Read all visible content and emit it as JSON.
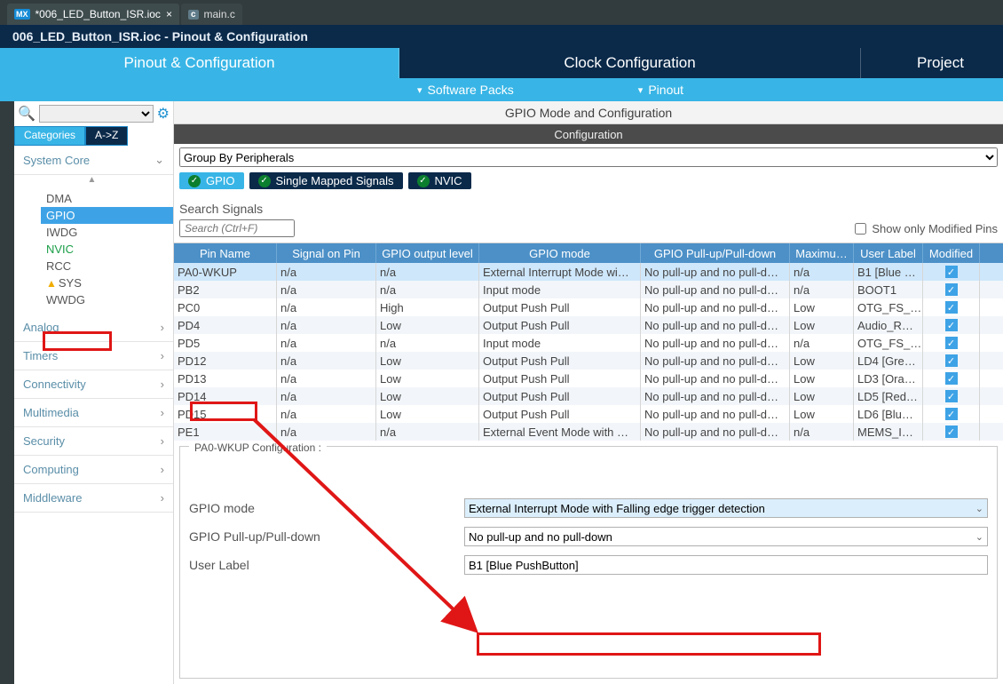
{
  "editorTabs": [
    {
      "label": "*006_LED_Button_ISR.ioc",
      "badge": "MX",
      "active": true,
      "closeable": true
    },
    {
      "label": "main.c",
      "badge": "c",
      "active": false,
      "closeable": false
    }
  ],
  "breadcrumb": "006_LED_Button_ISR.ioc - Pinout & Configuration",
  "bigTabs": {
    "pinout": "Pinout & Configuration",
    "clock": "Clock Configuration",
    "project": "Project"
  },
  "subMenus": {
    "packs": "Software Packs",
    "pinout": "Pinout"
  },
  "leftSearchPlaceholder": "",
  "modeTabs": {
    "categories": "Categories",
    "az": "A->Z"
  },
  "tree": {
    "systemCore": {
      "label": "System Core",
      "items": [
        {
          "label": "DMA"
        },
        {
          "label": "GPIO",
          "selected": true
        },
        {
          "label": "IWDG"
        },
        {
          "label": "NVIC",
          "green": true
        },
        {
          "label": "RCC"
        },
        {
          "label": "SYS",
          "warn": true
        },
        {
          "label": "WWDG"
        }
      ]
    },
    "sections": [
      "Analog",
      "Timers",
      "Connectivity",
      "Multimedia",
      "Security",
      "Computing",
      "Middleware"
    ]
  },
  "mainHeader": "GPIO Mode and Configuration",
  "configHeader": "Configuration",
  "groupByLabel": "Group By Peripherals",
  "pillTabs": {
    "gpio": "GPIO",
    "single": "Single Mapped Signals",
    "nvic": "NVIC"
  },
  "searchSignalsLabel": "Search Signals",
  "searchSignalsPlaceholder": "Search (Ctrl+F)",
  "showModifiedLabel": "Show only Modified Pins",
  "columns": {
    "pin": "Pin Name",
    "sig": "Signal on Pin",
    "out": "GPIO output level",
    "mode": "GPIO mode",
    "pull": "GPIO Pull-up/Pull-down",
    "max": "Maximu…",
    "lbl": "User Label",
    "mod": "Modified"
  },
  "rows": [
    {
      "pin": "PA0-WKUP",
      "sig": "n/a",
      "out": "n/a",
      "mode": "External Interrupt Mode wi…",
      "pull": "No pull-up and no pull-d…",
      "max": "n/a",
      "lbl": "B1 [Blue …",
      "mod": true,
      "sel": true
    },
    {
      "pin": "PB2",
      "sig": "n/a",
      "out": "n/a",
      "mode": "Input mode",
      "pull": "No pull-up and no pull-d…",
      "max": "n/a",
      "lbl": "BOOT1",
      "mod": true
    },
    {
      "pin": "PC0",
      "sig": "n/a",
      "out": "High",
      "mode": "Output Push Pull",
      "pull": "No pull-up and no pull-d…",
      "max": "Low",
      "lbl": "OTG_FS_…",
      "mod": true
    },
    {
      "pin": "PD4",
      "sig": "n/a",
      "out": "Low",
      "mode": "Output Push Pull",
      "pull": "No pull-up and no pull-d…",
      "max": "Low",
      "lbl": "Audio_R…",
      "mod": true
    },
    {
      "pin": "PD5",
      "sig": "n/a",
      "out": "n/a",
      "mode": "Input mode",
      "pull": "No pull-up and no pull-d…",
      "max": "n/a",
      "lbl": "OTG_FS_…",
      "mod": true
    },
    {
      "pin": "PD12",
      "sig": "n/a",
      "out": "Low",
      "mode": "Output Push Pull",
      "pull": "No pull-up and no pull-d…",
      "max": "Low",
      "lbl": "LD4 [Gre…",
      "mod": true
    },
    {
      "pin": "PD13",
      "sig": "n/a",
      "out": "Low",
      "mode": "Output Push Pull",
      "pull": "No pull-up and no pull-d…",
      "max": "Low",
      "lbl": "LD3 [Ora…",
      "mod": true
    },
    {
      "pin": "PD14",
      "sig": "n/a",
      "out": "Low",
      "mode": "Output Push Pull",
      "pull": "No pull-up and no pull-d…",
      "max": "Low",
      "lbl": "LD5 [Red…",
      "mod": true
    },
    {
      "pin": "PD15",
      "sig": "n/a",
      "out": "Low",
      "mode": "Output Push Pull",
      "pull": "No pull-up and no pull-d…",
      "max": "Low",
      "lbl": "LD6 [Blu…",
      "mod": true
    },
    {
      "pin": "PE1",
      "sig": "n/a",
      "out": "n/a",
      "mode": "External Event Mode with …",
      "pull": "No pull-up and no pull-d…",
      "max": "n/a",
      "lbl": "MEMS_I…",
      "mod": true
    }
  ],
  "cfgTitle": "PA0-WKUP Configuration :",
  "cfg": {
    "modeLabel": "GPIO mode",
    "modeValue": "External Interrupt Mode with Falling edge trigger detection",
    "pullLabel": "GPIO Pull-up/Pull-down",
    "pullValue": "No pull-up and no pull-down",
    "userLabelLabel": "User Label",
    "userLabelValue": "B1 [Blue PushButton]"
  }
}
